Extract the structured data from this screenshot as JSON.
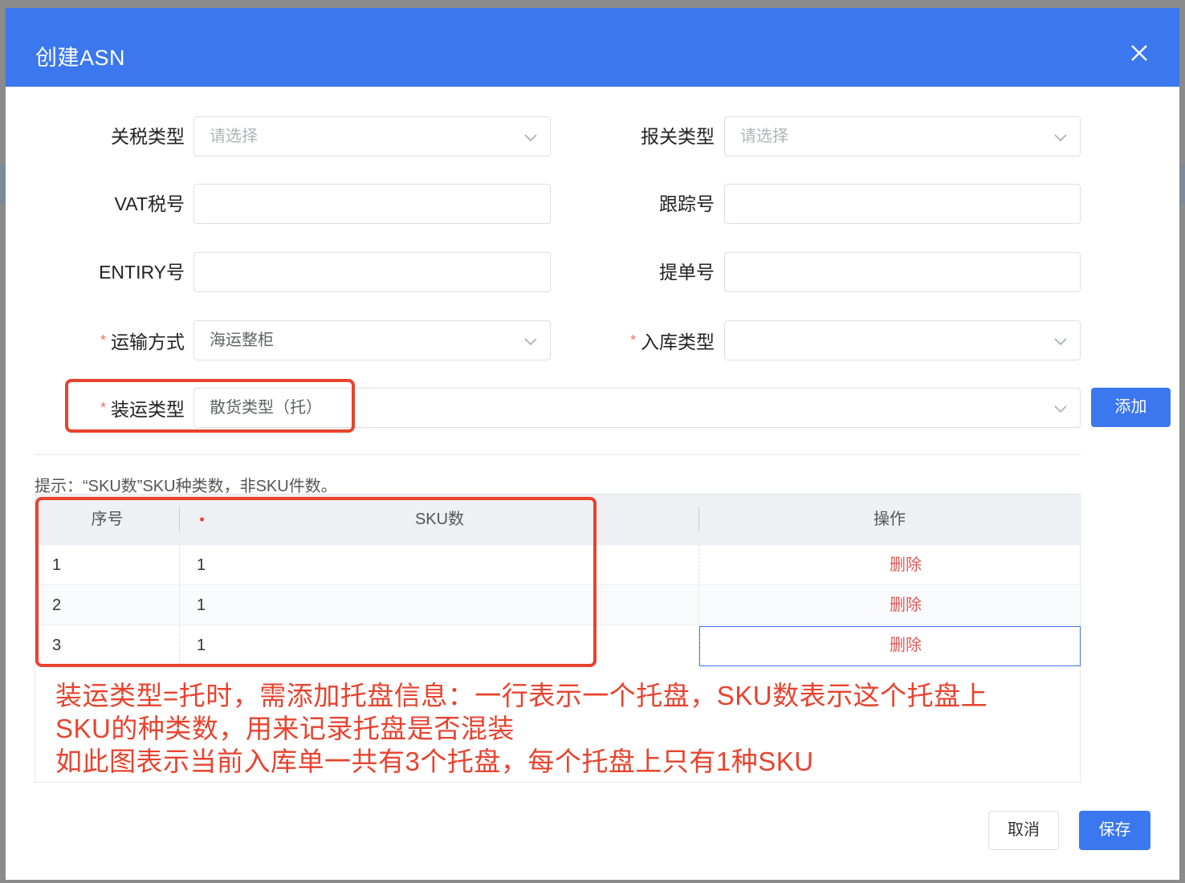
{
  "dialog": {
    "title": "创建ASN"
  },
  "form": {
    "tariff_type": {
      "label": "关税类型",
      "placeholder": "请选择",
      "required": false
    },
    "customs_type": {
      "label": "报关类型",
      "placeholder": "请选择",
      "required": false
    },
    "vat_number": {
      "label": "VAT税号",
      "value": ""
    },
    "tracking_number": {
      "label": "跟踪号",
      "value": ""
    },
    "entry_number": {
      "label": "ENTIRY号",
      "value": ""
    },
    "bill_number": {
      "label": "提单号",
      "value": ""
    },
    "transport_mode": {
      "label": "运输方式",
      "value": "海运整柜",
      "required": true
    },
    "inbound_type": {
      "label": "入库类型",
      "value": "",
      "required": true
    },
    "shipping_type": {
      "label": "装运类型",
      "value": "散货类型（托）",
      "required": true
    },
    "required_mark": "*",
    "add_label": "添加"
  },
  "hint": "提示：“SKU数”SKU种类数，非SKU件数。",
  "table": {
    "columns": {
      "index": "序号",
      "sku_count": "SKU数",
      "sku_required_mark": "•",
      "actions": "操作"
    },
    "rows": [
      {
        "index": "1",
        "sku_count": "1",
        "action": "删除"
      },
      {
        "index": "2",
        "sku_count": "1",
        "action": "删除"
      },
      {
        "index": "3",
        "sku_count": "1",
        "action": "删除"
      }
    ]
  },
  "annotation": {
    "lines": [
      "装运类型=托时，需添加托盘信息：一行表示一个托盘，SKU数表示这个托盘上",
      "SKU的种类数，用来记录托盘是否混装",
      "如此图表示当前入库单一共有3个托盘，每个托盘上只有1种SKU"
    ]
  },
  "footer": {
    "cancel_label": "取消",
    "save_label": "保存"
  },
  "colors": {
    "primary": "#3b77ee",
    "danger": "#e15757",
    "annotation": "#e8432e"
  }
}
